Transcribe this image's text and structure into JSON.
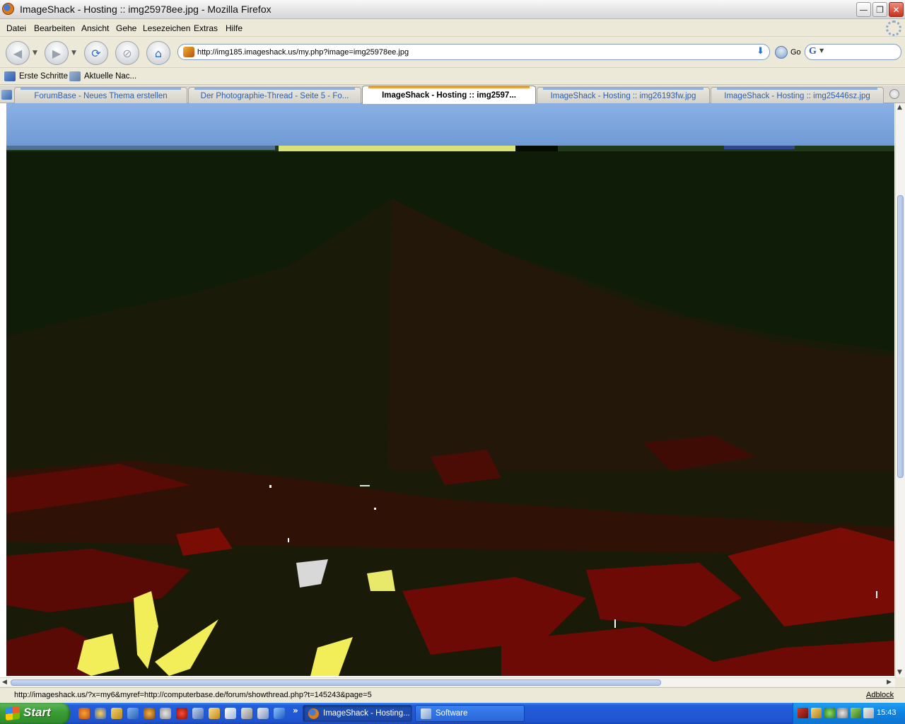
{
  "window": {
    "title": "ImageShack - Hosting :: img25978ee.jpg - Mozilla Firefox",
    "minimize_icon": "minimize-icon",
    "maximize_icon": "restore-icon",
    "close_icon": "close-icon"
  },
  "menu": {
    "items": [
      "Datei",
      "Bearbeiten",
      "Ansicht",
      "Gehe",
      "Lesezeichen",
      "Extras",
      "Hilfe"
    ]
  },
  "toolbar": {
    "url": "http://img185.imageshack.us/my.php?image=img25978ee.jpg",
    "go_label": "Go",
    "search_engine": "G",
    "search_value": ""
  },
  "bookmarks": {
    "items": [
      "Erste Schritte",
      "Aktuelle Nac..."
    ]
  },
  "tabs": [
    {
      "label": "ForumBase - Neues Thema erstellen",
      "active": false
    },
    {
      "label": "Der Photographie-Thread - Seite 5 - Fo...",
      "active": false
    },
    {
      "label": "ImageShack - Hosting :: img2597...",
      "active": true
    },
    {
      "label": "ImageShack - Hosting :: img26193fw.jpg",
      "active": false
    },
    {
      "label": "ImageShack - Hosting :: img25446sz.jpg",
      "active": false
    }
  ],
  "status": {
    "text": "http://imageshack.us/?x=my6&myref=http://computerbase.de/forum/showthread.php?t=145243&page=5",
    "adblock": "Adblock"
  },
  "taskbar": {
    "start_label": "Start",
    "quicklaunch_more": "»",
    "windows": [
      {
        "label": "ImageShack - Hosting...",
        "active": true,
        "icon": "firefox-icon"
      },
      {
        "label": "Software",
        "active": false,
        "icon": "folder-icon"
      }
    ],
    "clock": "15:43"
  },
  "colors": {
    "sky": "#7aa4dc",
    "photo_dark": "#0d1a08",
    "roofs": "#6e0a06",
    "highlight": "#f2ee5a",
    "taskbar": "#245edb"
  }
}
